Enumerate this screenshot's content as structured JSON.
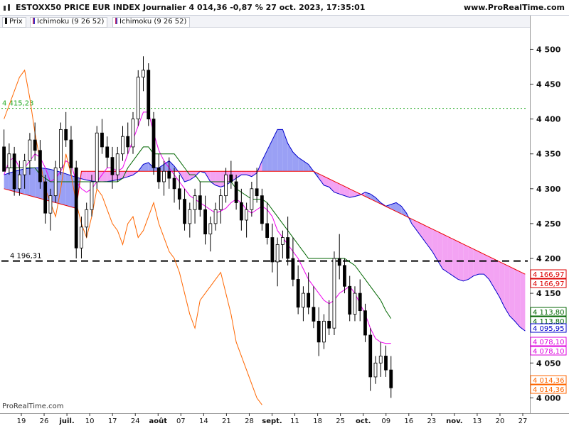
{
  "header": {
    "title": "ESTOXX50 PRICE EUR INDEX Journalier 4 014,36 -0,87 % 27 oct. 2023, 17:35:01",
    "brand": "www.ProRealTime.com"
  },
  "legend": [
    {
      "label": "Prix",
      "color": "#111111"
    },
    {
      "label": "Ichimoku (9 26 52)",
      "color": "#cc3366"
    },
    {
      "label": "Ichimoku (9 26 52)",
      "color": "#cc3366"
    }
  ],
  "footer_brand": "ProRealTime.com",
  "chart_data": {
    "type": "candlestick",
    "title": "ESTOXX50 PRICE EUR INDEX Journalier",
    "ylim": [
      3980,
      4530
    ],
    "yticks": [
      {
        "value": 4500,
        "label": "4 500"
      },
      {
        "value": 4450,
        "label": "4 450"
      },
      {
        "value": 4400,
        "label": "4 400"
      },
      {
        "value": 4350,
        "label": "4 350"
      },
      {
        "value": 4300,
        "label": "4 300"
      },
      {
        "value": 4250,
        "label": "4 250"
      },
      {
        "value": 4200,
        "label": "4 200"
      },
      {
        "value": 4150,
        "label": "4 150"
      },
      {
        "value": 4050,
        "label": "4 050"
      },
      {
        "value": 4000,
        "label": "4 000"
      }
    ],
    "xticks": [
      "19",
      "26",
      "juil.",
      "10",
      "17",
      "24",
      "août",
      "07",
      "14",
      "21",
      "28",
      "sept.",
      "11",
      "18",
      "25",
      "oct.",
      "09",
      "16",
      "23",
      "nov.",
      "13",
      "20",
      "27"
    ],
    "bold_xticks": [
      "juil.",
      "août",
      "sept.",
      "oct.",
      "nov."
    ],
    "hlines": [
      {
        "value": 4415.23,
        "label": "4 415,23",
        "style": "dotted",
        "color": "#22aa22"
      },
      {
        "value": 4196.31,
        "label": "4 196,31",
        "style": "dashed",
        "color": "#000000"
      }
    ],
    "right_labels": [
      {
        "value": 4166.97,
        "label": "4 166,97",
        "color": "#dd0000"
      },
      {
        "value": 4166.97,
        "label": "4 166,97",
        "color": "#dd0000"
      },
      {
        "value": 4113.8,
        "label": "4 113,80",
        "color": "#006600"
      },
      {
        "value": 4113.8,
        "label": "4 113,80",
        "color": "#006600"
      },
      {
        "value": 4095.95,
        "label": "4 095,95",
        "color": "#0000cc"
      },
      {
        "value": 4078.1,
        "label": "4 078,10",
        "color": "#dd00dd"
      },
      {
        "value": 4078.1,
        "label": "4 078,10",
        "color": "#dd00dd"
      },
      {
        "value": 4014.36,
        "label": "4 014,36",
        "color": "#ff6600"
      },
      {
        "value": 4014.36,
        "label": "4 014,36",
        "color": "#ff6600"
      }
    ],
    "candles": [
      [
        4360,
        4385,
        4330,
        4325
      ],
      [
        4330,
        4365,
        4320,
        4350
      ],
      [
        4350,
        4360,
        4290,
        4300
      ],
      [
        4300,
        4340,
        4290,
        4320
      ],
      [
        4320,
        4350,
        4300,
        4340
      ],
      [
        4340,
        4380,
        4320,
        4370
      ],
      [
        4370,
        4395,
        4340,
        4355
      ],
      [
        4355,
        4370,
        4300,
        4310
      ],
      [
        4310,
        4320,
        4250,
        4265
      ],
      [
        4265,
        4300,
        4240,
        4290
      ],
      [
        4290,
        4340,
        4280,
        4330
      ],
      [
        4330,
        4395,
        4320,
        4385
      ],
      [
        4385,
        4410,
        4360,
        4370
      ],
      [
        4370,
        4390,
        4320,
        4330
      ],
      [
        4330,
        4340,
        4200,
        4215
      ],
      [
        4215,
        4260,
        4200,
        4245
      ],
      [
        4245,
        4280,
        4230,
        4270
      ],
      [
        4270,
        4320,
        4260,
        4310
      ],
      [
        4310,
        4390,
        4300,
        4380
      ],
      [
        4380,
        4400,
        4350,
        4360
      ],
      [
        4360,
        4375,
        4330,
        4345
      ],
      [
        4345,
        4360,
        4300,
        4320
      ],
      [
        4320,
        4360,
        4310,
        4350
      ],
      [
        4350,
        4390,
        4340,
        4375
      ],
      [
        4375,
        4395,
        4350,
        4360
      ],
      [
        4360,
        4410,
        4350,
        4400
      ],
      [
        4400,
        4470,
        4390,
        4460
      ],
      [
        4460,
        4490,
        4440,
        4470
      ],
      [
        4470,
        4480,
        4390,
        4400
      ],
      [
        4400,
        4410,
        4320,
        4330
      ],
      [
        4330,
        4350,
        4300,
        4310
      ],
      [
        4310,
        4340,
        4290,
        4325
      ],
      [
        4325,
        4345,
        4300,
        4315
      ],
      [
        4315,
        4330,
        4280,
        4300
      ],
      [
        4300,
        4320,
        4270,
        4285
      ],
      [
        4285,
        4300,
        4240,
        4250
      ],
      [
        4250,
        4280,
        4230,
        4270
      ],
      [
        4270,
        4300,
        4250,
        4290
      ],
      [
        4290,
        4310,
        4260,
        4270
      ],
      [
        4270,
        4290,
        4220,
        4235
      ],
      [
        4235,
        4260,
        4210,
        4250
      ],
      [
        4250,
        4280,
        4240,
        4270
      ],
      [
        4270,
        4300,
        4250,
        4290
      ],
      [
        4290,
        4330,
        4280,
        4320
      ],
      [
        4320,
        4340,
        4300,
        4310
      ],
      [
        4310,
        4320,
        4270,
        4280
      ],
      [
        4280,
        4300,
        4240,
        4255
      ],
      [
        4255,
        4280,
        4230,
        4270
      ],
      [
        4270,
        4310,
        4260,
        4300
      ],
      [
        4300,
        4330,
        4280,
        4290
      ],
      [
        4290,
        4300,
        4240,
        4250
      ],
      [
        4250,
        4280,
        4220,
        4230
      ],
      [
        4230,
        4250,
        4180,
        4195
      ],
      [
        4195,
        4230,
        4160,
        4220
      ],
      [
        4220,
        4240,
        4200,
        4230
      ],
      [
        4230,
        4260,
        4190,
        4200
      ],
      [
        4200,
        4230,
        4160,
        4170
      ],
      [
        4170,
        4190,
        4120,
        4130
      ],
      [
        4130,
        4160,
        4110,
        4150
      ],
      [
        4150,
        4180,
        4120,
        4130
      ],
      [
        4130,
        4160,
        4100,
        4110
      ],
      [
        4110,
        4130,
        4060,
        4080
      ],
      [
        4080,
        4120,
        4070,
        4110
      ],
      [
        4110,
        4140,
        4090,
        4100
      ],
      [
        4100,
        4210,
        4090,
        4200
      ],
      [
        4200,
        4235,
        4170,
        4190
      ],
      [
        4190,
        4200,
        4150,
        4160
      ],
      [
        4160,
        4175,
        4110,
        4120
      ],
      [
        4120,
        4160,
        4110,
        4150
      ],
      [
        4150,
        4170,
        4110,
        4125
      ],
      [
        4125,
        4135,
        4080,
        4090
      ],
      [
        4090,
        4100,
        4010,
        4030
      ],
      [
        4030,
        4060,
        4020,
        4050
      ],
      [
        4050,
        4080,
        4030,
        4060
      ],
      [
        4060,
        4075,
        4030,
        4040
      ],
      [
        4040,
        4060,
        4000,
        4014.36
      ]
    ],
    "series": [
      {
        "name": "Tenkan",
        "color": "#ee00ee",
        "values": [
          4320,
          4340,
          4345,
          4330,
          4330,
          4340,
          4350,
          4345,
          4330,
          4310,
          4315,
          4325,
          4340,
          4335,
          4310,
          4300,
          4295,
          4300,
          4310,
          4320,
          4330,
          4330,
          4325,
          4330,
          4350,
          4370,
          4390,
          4410,
          4410,
          4380,
          4355,
          4340,
          4330,
          4320,
          4310,
          4300,
          4290,
          4285,
          4280,
          4275,
          4270,
          4265,
          4268,
          4272,
          4280,
          4285,
          4280,
          4270,
          4265,
          4270,
          4275,
          4270,
          4260,
          4240,
          4230,
          4220,
          4210,
          4200,
          4185,
          4170,
          4160,
          4150,
          4140,
          4135,
          4140,
          4150,
          4155,
          4160,
          4150,
          4135,
          4120,
          4100,
          4085,
          4080,
          4078,
          4078.1
        ]
      },
      {
        "name": "Kijun",
        "color": "#006600",
        "values": [
          4330,
          4330,
          4330,
          4330,
          4330,
          4330,
          4330,
          4320,
          4315,
          4310,
          4310,
          4310,
          4310,
          4310,
          4310,
          4310,
          4310,
          4310,
          4310,
          4310,
          4310,
          4310,
          4310,
          4315,
          4330,
          4340,
          4350,
          4360,
          4360,
          4350,
          4350,
          4350,
          4350,
          4350,
          4340,
          4330,
          4320,
          4320,
          4310,
          4310,
          4310,
          4310,
          4310,
          4310,
          4310,
          4300,
          4295,
          4290,
          4285,
          4285,
          4285,
          4280,
          4270,
          4260,
          4250,
          4240,
          4230,
          4220,
          4210,
          4200,
          4200,
          4200,
          4200,
          4200,
          4200,
          4200,
          4200,
          4195,
          4190,
          4180,
          4170,
          4160,
          4150,
          4140,
          4125,
          4113.8
        ]
      },
      {
        "name": "Chikou",
        "color": "#ff6600",
        "values": [
          4400,
          4420,
          4440,
          4460,
          4470,
          4430,
          4380,
          4340,
          4300,
          4280,
          4260,
          4300,
          4350,
          4320,
          4280,
          4250,
          4230,
          4260,
          4300,
          4290,
          4270,
          4250,
          4240,
          4220,
          4250,
          4260,
          4230,
          4240,
          4260,
          4280,
          4250,
          4230,
          4210,
          4200,
          4180,
          4150,
          4120,
          4100,
          4140,
          4150,
          4160,
          4170,
          4180,
          4150,
          4120,
          4080,
          4060,
          4040,
          4020,
          4000,
          3990
        ]
      }
    ]
  }
}
